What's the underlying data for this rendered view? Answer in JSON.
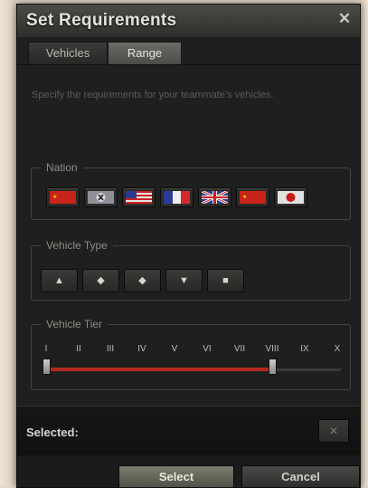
{
  "dialog": {
    "title": "Set Requirements",
    "close_glyph": "✕"
  },
  "tabs": [
    {
      "label": "Vehicles",
      "active": false
    },
    {
      "label": "Range",
      "active": true
    }
  ],
  "description": "Specify the requirements for your teammate's vehicles.",
  "nation": {
    "legend": "Nation",
    "flags": [
      "china",
      "germany",
      "usa",
      "france",
      "uk",
      "china",
      "japan"
    ]
  },
  "vehicle_type": {
    "legend": "Vehicle Type",
    "types": [
      {
        "icon": "light-tank-icon",
        "glyph": "▲"
      },
      {
        "icon": "medium-tank-icon",
        "glyph": "◆"
      },
      {
        "icon": "heavy-tank-icon",
        "glyph": "◆"
      },
      {
        "icon": "tank-destroyer-icon",
        "glyph": "▼"
      },
      {
        "icon": "spg-icon",
        "glyph": "■"
      }
    ]
  },
  "vehicle_tier": {
    "legend": "Vehicle Tier",
    "tiers": [
      "I",
      "II",
      "III",
      "IV",
      "V",
      "VI",
      "VII",
      "VIII",
      "IX",
      "X"
    ],
    "range_min": "I",
    "range_max": "VIII",
    "fill_color": "#b22a1e"
  },
  "selected": {
    "label": "Selected:",
    "clear_glyph": "✕"
  },
  "buttons": {
    "select": "Select",
    "cancel": "Cancel"
  }
}
